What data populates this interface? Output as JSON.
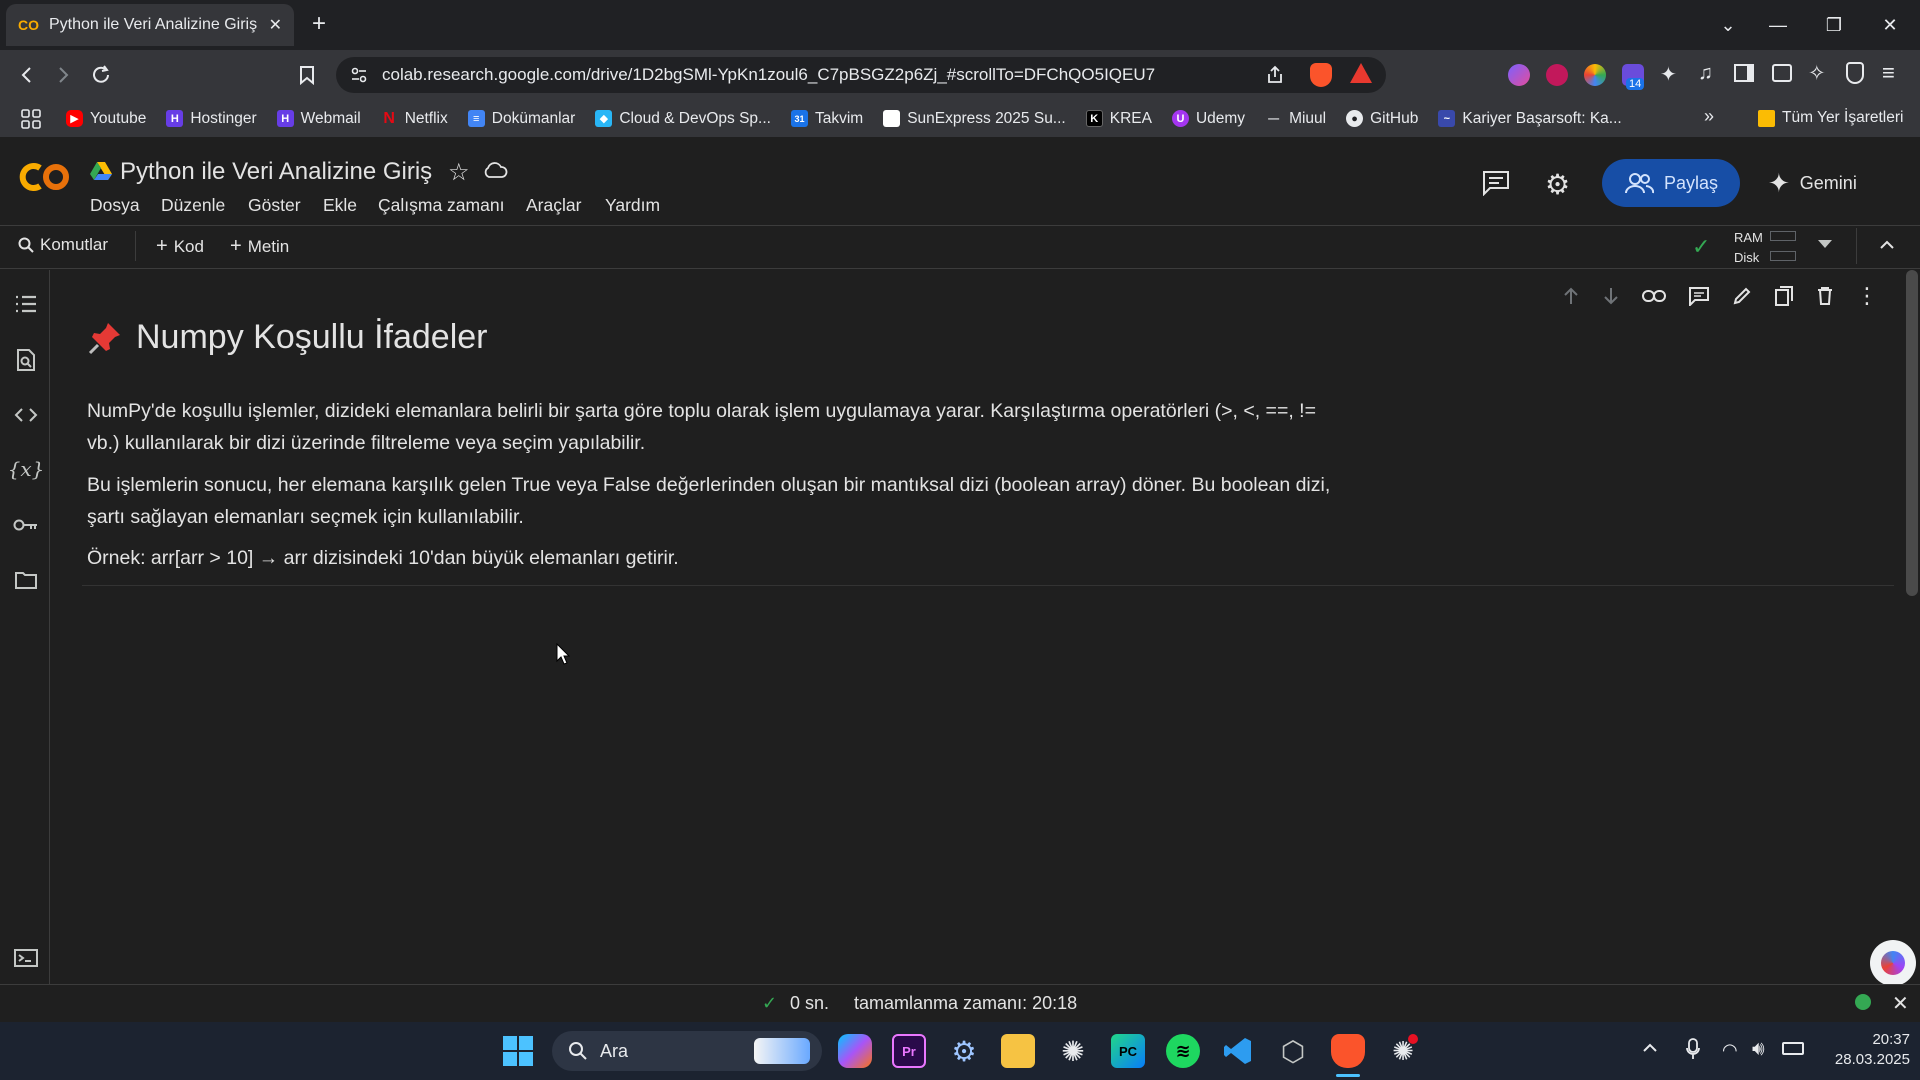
{
  "browser": {
    "tab_title": "Python ile Veri Analizine Giriş -",
    "new_tab": "+",
    "url": "colab.research.google.com/drive/1D2bgSMl-YpKn1zoul6_C7pBSGZ2p6Zj_#scrollTo=DFChQO5IQEU7",
    "extension_badge": "14",
    "bookmarks": [
      "Youtube",
      "Hostinger",
      "Webmail",
      "Netflix",
      "Dokümanlar",
      "Cloud & DevOps Sp...",
      "Takvim",
      "SunExpress 2025 Su...",
      "KREA",
      "Udemy",
      "Miuul",
      "GitHub",
      "Kariyer Başarsoft: Ka..."
    ],
    "all_bookmarks": "Tüm Yer İşaretleri"
  },
  "colab": {
    "logo": "CO",
    "title": "Python ile Veri Analizine Giriş",
    "menus": [
      "Dosya",
      "Düzenle",
      "Göster",
      "Ekle",
      "Çalışma zamanı",
      "Araçlar",
      "Yardım"
    ],
    "share_label": "Paylaş",
    "gemini_label": "Gemini",
    "toolbar": {
      "commands": "Komutlar",
      "add_code": "Kod",
      "add_text": "Metin",
      "ram": "RAM",
      "disk": "Disk"
    }
  },
  "cell": {
    "heading": "Numpy Koşullu İfadeler",
    "p1": "NumPy'de koşullu işlemler, dizideki elemanlara belirli bir şarta göre toplu olarak işlem uygulamaya yarar. Karşılaştırma operatörleri (>, <, ==, != vb.) kullanılarak bir dizi üzerinde filtreleme veya seçim yapılabilir.",
    "p2": "Bu işlemlerin sonucu, her elemana karşılık gelen True veya False değerlerinden oluşan bir mantıksal dizi (boolean array) döner. Bu boolean dizi, şartı sağlayan elemanları seçmek için kullanılabilir.",
    "p3": "Örnek: arr[arr > 10] → arr dizisindeki 10'dan büyük elemanları getirir."
  },
  "status": {
    "duration": "0 sn.",
    "completed": "tamamlanma zamanı: 20:18"
  },
  "taskbar": {
    "search": "Ara",
    "time": "20:37",
    "date": "28.03.2025"
  },
  "colors": {
    "accent": "#174ea6",
    "ok": "#34a853",
    "bg": "#1f1f1f"
  }
}
